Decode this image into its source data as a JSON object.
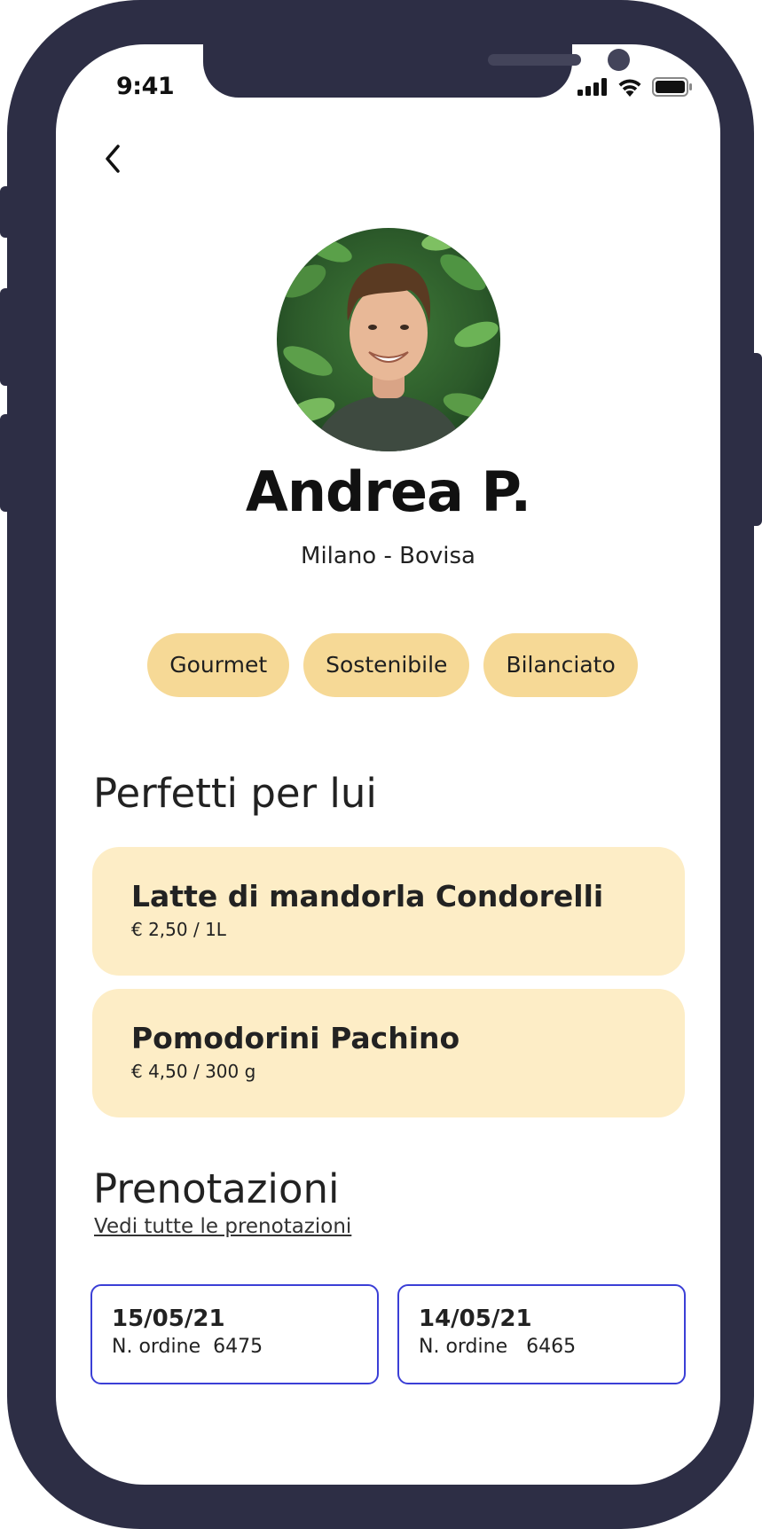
{
  "status_bar": {
    "time": "9:41"
  },
  "profile": {
    "name": "Andrea P.",
    "location": "Milano - Bovisa",
    "tags": [
      "Gourmet",
      "Sostenibile",
      "Bilanciato"
    ]
  },
  "recommendations": {
    "title": "Perfetti per lui",
    "items": [
      {
        "name": "Latte di mandorla Condorelli",
        "price": "€ 2,50 / 1L"
      },
      {
        "name": "Pomodorini Pachino",
        "price": "€ 4,50 / 300 g"
      }
    ]
  },
  "bookings": {
    "title": "Prenotazioni",
    "see_all": "Vedi tutte le prenotazioni",
    "items": [
      {
        "date": "15/05/21",
        "order": "N. ordine  6475"
      },
      {
        "date": "14/05/21",
        "order": "N. ordine   6465"
      }
    ]
  },
  "colors": {
    "frame": "#2d2e45",
    "tag_bg": "#f6d996",
    "product_bg": "#fdedc6",
    "booking_border": "#3b3fd6"
  },
  "icons": {
    "back": "chevron-left-icon",
    "signal": "signal-icon",
    "wifi": "wifi-icon",
    "battery": "battery-icon"
  }
}
